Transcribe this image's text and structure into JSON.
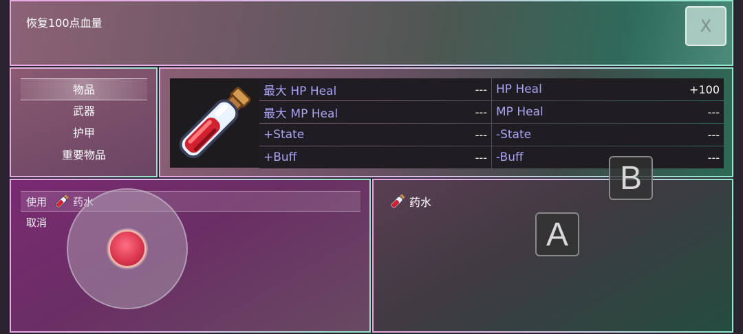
{
  "help": {
    "text": "恢复100点血量"
  },
  "close_button": {
    "label": "X"
  },
  "categories": [
    {
      "label": "物品",
      "selected": true
    },
    {
      "label": "武器",
      "selected": false
    },
    {
      "label": "护甲",
      "selected": false
    },
    {
      "label": "重要物品",
      "selected": false
    }
  ],
  "item_status": {
    "icon": "potion-icon",
    "rows": [
      {
        "left_label": "最大 HP Heal",
        "left_value": "---",
        "right_label": "HP Heal",
        "right_value": "+100"
      },
      {
        "left_label": "最大 MP Heal",
        "left_value": "---",
        "right_label": "MP Heal",
        "right_value": "---"
      },
      {
        "left_label": "+State",
        "left_value": "---",
        "right_label": "-State",
        "right_value": "---"
      },
      {
        "left_label": "+Buff",
        "left_value": "---",
        "right_label": "-Buff",
        "right_value": "---"
      }
    ]
  },
  "commands": {
    "use_label": "使用",
    "item_name": "药水",
    "cancel_label": "取消"
  },
  "target_list": {
    "item_name": "药水"
  },
  "virtual_controls": {
    "button_a": "A",
    "button_b": "B"
  },
  "colors": {
    "stat_label": "#a9a3f6",
    "cell_bg": "#1f1d22",
    "knob": "#d7344c"
  }
}
